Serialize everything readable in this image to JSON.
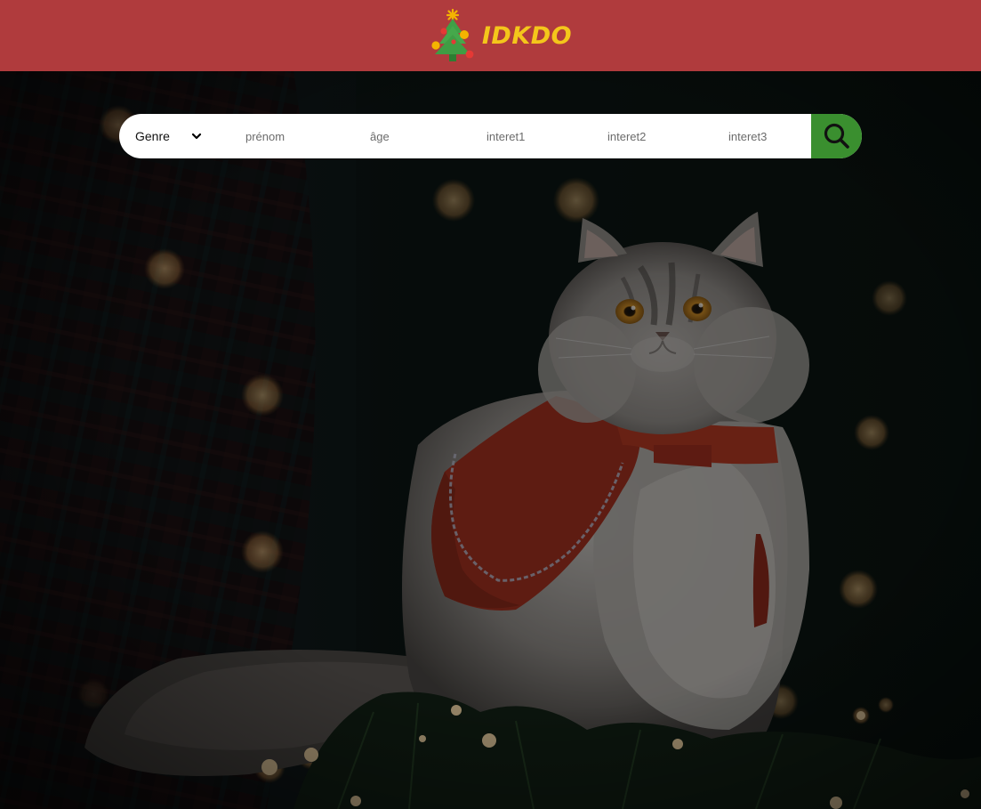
{
  "header": {
    "brand": "IDKDO",
    "logo_icon": "christmas-tree-icon",
    "background_color": "#b03b3d",
    "brand_color": "#f4c61b"
  },
  "search": {
    "genre": {
      "selected": "Genre",
      "icon": "chevron-down-icon"
    },
    "prenom_placeholder": "prénom",
    "age_placeholder": "âge",
    "interet1_placeholder": "interet1",
    "interet2_placeholder": "interet2",
    "interet3_placeholder": "interet3",
    "button_icon": "search-icon",
    "button_color": "#3a8f2f"
  },
  "hero": {
    "image": "cat-in-red-cape-with-christmas-lights"
  }
}
